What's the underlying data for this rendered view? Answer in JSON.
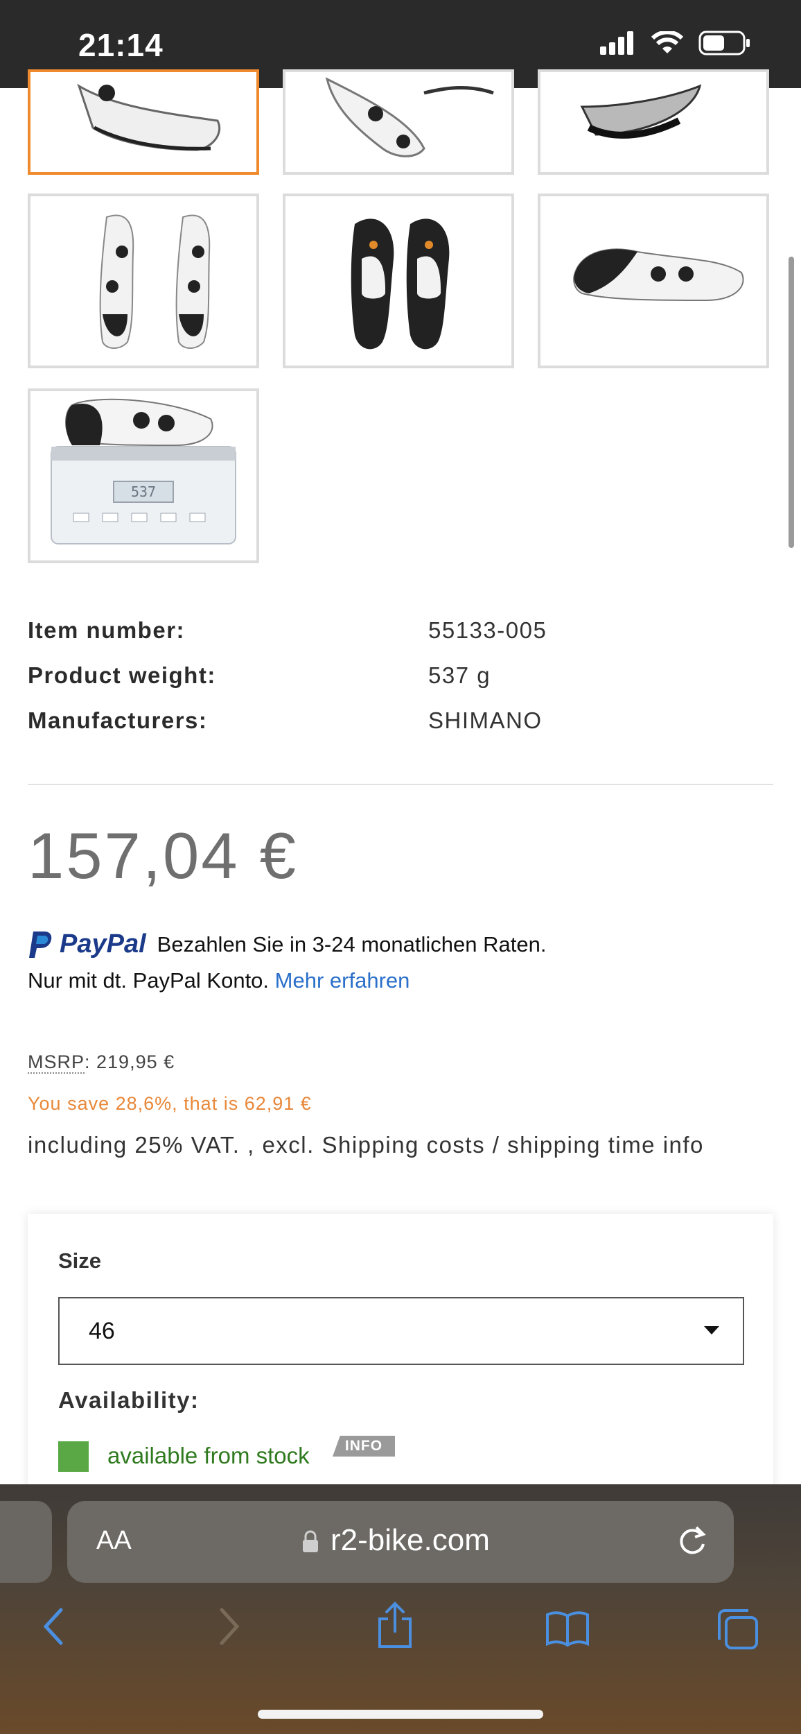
{
  "status_bar": {
    "time": "21:14",
    "icons": [
      "cellular-signal-icon",
      "wifi-icon",
      "battery-icon"
    ]
  },
  "gallery": {
    "thumbnails": [
      {
        "name": "shoe-front-view"
      },
      {
        "name": "shoe-top-view"
      },
      {
        "name": "shoe-rear-view"
      },
      {
        "name": "shoes-pair-top-view"
      },
      {
        "name": "shoes-soles-view"
      },
      {
        "name": "shoe-side-view"
      },
      {
        "name": "shoe-on-scale"
      }
    ],
    "scale_readout": "537"
  },
  "specs": {
    "item_number_label": "Item number:",
    "item_number": "55133-005",
    "weight_label": "Product weight:",
    "weight": "537 g",
    "manufacturer_label": "Manufacturers:",
    "manufacturer": "SHIMANO"
  },
  "price": "157,04 €",
  "paypal": {
    "logo": "PayPal",
    "text": "Bezahlen Sie in 3-24 monatlichen Raten.",
    "line2": "Nur mit dt. PayPal Konto.",
    "link": "Mehr erfahren"
  },
  "msrp": {
    "label": "MSRP",
    "value": ": 219,95 €"
  },
  "savings": "You save 28,6%, that is 62,91 €",
  "vat_info": "including 25% VAT. , excl. Shipping costs / shipping time info",
  "options": {
    "size_label": "Size",
    "size_value": "46",
    "availability_label": "Availability:",
    "availability_text": "available from stock",
    "info_badge": "INFO"
  },
  "browser": {
    "aa_label": "AA",
    "url": "r2-bike.com"
  },
  "colors": {
    "accent_orange": "#ef8a2e",
    "savings_orange": "#e8883a",
    "paypal_blue": "#1b3b8a",
    "link_blue": "#2a6fc9",
    "stock_green": "#5aa845"
  }
}
